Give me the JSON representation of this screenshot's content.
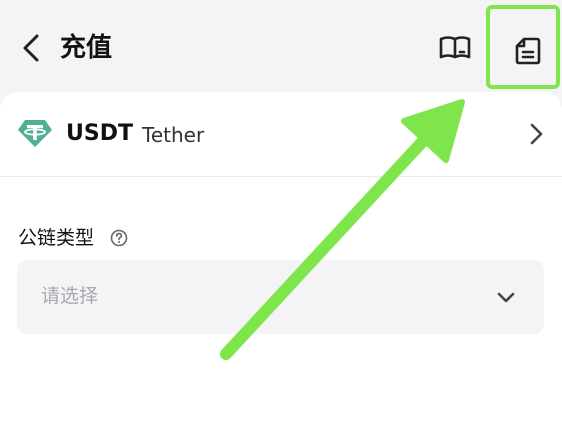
{
  "header": {
    "title": "充值",
    "back_icon": "chevron-left-icon",
    "guide_icon": "book-icon",
    "record_icon": "document-icon"
  },
  "coin": {
    "symbol": "USDT",
    "name": "Tether",
    "icon": "tether-logo-icon",
    "brand_color": "#50af95"
  },
  "chain": {
    "label": "公链类型",
    "help_icon": "help-circle-icon",
    "placeholder": "请选择"
  },
  "annotation": {
    "highlight_color": "#7ee64a"
  }
}
